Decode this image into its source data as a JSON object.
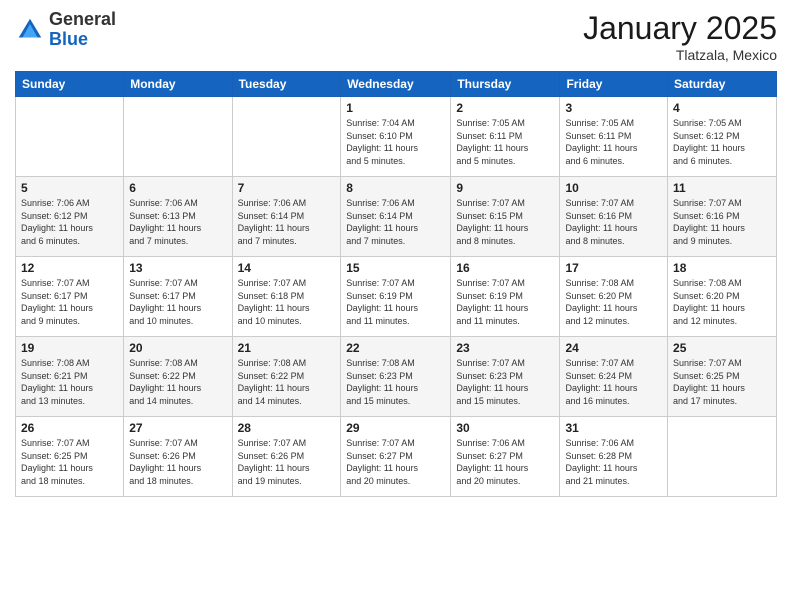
{
  "logo": {
    "general": "General",
    "blue": "Blue"
  },
  "header": {
    "month": "January 2025",
    "location": "Tlatzala, Mexico"
  },
  "weekdays": [
    "Sunday",
    "Monday",
    "Tuesday",
    "Wednesday",
    "Thursday",
    "Friday",
    "Saturday"
  ],
  "weeks": [
    [
      {
        "day": "",
        "info": ""
      },
      {
        "day": "",
        "info": ""
      },
      {
        "day": "",
        "info": ""
      },
      {
        "day": "1",
        "info": "Sunrise: 7:04 AM\nSunset: 6:10 PM\nDaylight: 11 hours\nand 5 minutes."
      },
      {
        "day": "2",
        "info": "Sunrise: 7:05 AM\nSunset: 6:11 PM\nDaylight: 11 hours\nand 5 minutes."
      },
      {
        "day": "3",
        "info": "Sunrise: 7:05 AM\nSunset: 6:11 PM\nDaylight: 11 hours\nand 6 minutes."
      },
      {
        "day": "4",
        "info": "Sunrise: 7:05 AM\nSunset: 6:12 PM\nDaylight: 11 hours\nand 6 minutes."
      }
    ],
    [
      {
        "day": "5",
        "info": "Sunrise: 7:06 AM\nSunset: 6:12 PM\nDaylight: 11 hours\nand 6 minutes."
      },
      {
        "day": "6",
        "info": "Sunrise: 7:06 AM\nSunset: 6:13 PM\nDaylight: 11 hours\nand 7 minutes."
      },
      {
        "day": "7",
        "info": "Sunrise: 7:06 AM\nSunset: 6:14 PM\nDaylight: 11 hours\nand 7 minutes."
      },
      {
        "day": "8",
        "info": "Sunrise: 7:06 AM\nSunset: 6:14 PM\nDaylight: 11 hours\nand 7 minutes."
      },
      {
        "day": "9",
        "info": "Sunrise: 7:07 AM\nSunset: 6:15 PM\nDaylight: 11 hours\nand 8 minutes."
      },
      {
        "day": "10",
        "info": "Sunrise: 7:07 AM\nSunset: 6:16 PM\nDaylight: 11 hours\nand 8 minutes."
      },
      {
        "day": "11",
        "info": "Sunrise: 7:07 AM\nSunset: 6:16 PM\nDaylight: 11 hours\nand 9 minutes."
      }
    ],
    [
      {
        "day": "12",
        "info": "Sunrise: 7:07 AM\nSunset: 6:17 PM\nDaylight: 11 hours\nand 9 minutes."
      },
      {
        "day": "13",
        "info": "Sunrise: 7:07 AM\nSunset: 6:17 PM\nDaylight: 11 hours\nand 10 minutes."
      },
      {
        "day": "14",
        "info": "Sunrise: 7:07 AM\nSunset: 6:18 PM\nDaylight: 11 hours\nand 10 minutes."
      },
      {
        "day": "15",
        "info": "Sunrise: 7:07 AM\nSunset: 6:19 PM\nDaylight: 11 hours\nand 11 minutes."
      },
      {
        "day": "16",
        "info": "Sunrise: 7:07 AM\nSunset: 6:19 PM\nDaylight: 11 hours\nand 11 minutes."
      },
      {
        "day": "17",
        "info": "Sunrise: 7:08 AM\nSunset: 6:20 PM\nDaylight: 11 hours\nand 12 minutes."
      },
      {
        "day": "18",
        "info": "Sunrise: 7:08 AM\nSunset: 6:20 PM\nDaylight: 11 hours\nand 12 minutes."
      }
    ],
    [
      {
        "day": "19",
        "info": "Sunrise: 7:08 AM\nSunset: 6:21 PM\nDaylight: 11 hours\nand 13 minutes."
      },
      {
        "day": "20",
        "info": "Sunrise: 7:08 AM\nSunset: 6:22 PM\nDaylight: 11 hours\nand 14 minutes."
      },
      {
        "day": "21",
        "info": "Sunrise: 7:08 AM\nSunset: 6:22 PM\nDaylight: 11 hours\nand 14 minutes."
      },
      {
        "day": "22",
        "info": "Sunrise: 7:08 AM\nSunset: 6:23 PM\nDaylight: 11 hours\nand 15 minutes."
      },
      {
        "day": "23",
        "info": "Sunrise: 7:07 AM\nSunset: 6:23 PM\nDaylight: 11 hours\nand 15 minutes."
      },
      {
        "day": "24",
        "info": "Sunrise: 7:07 AM\nSunset: 6:24 PM\nDaylight: 11 hours\nand 16 minutes."
      },
      {
        "day": "25",
        "info": "Sunrise: 7:07 AM\nSunset: 6:25 PM\nDaylight: 11 hours\nand 17 minutes."
      }
    ],
    [
      {
        "day": "26",
        "info": "Sunrise: 7:07 AM\nSunset: 6:25 PM\nDaylight: 11 hours\nand 18 minutes."
      },
      {
        "day": "27",
        "info": "Sunrise: 7:07 AM\nSunset: 6:26 PM\nDaylight: 11 hours\nand 18 minutes."
      },
      {
        "day": "28",
        "info": "Sunrise: 7:07 AM\nSunset: 6:26 PM\nDaylight: 11 hours\nand 19 minutes."
      },
      {
        "day": "29",
        "info": "Sunrise: 7:07 AM\nSunset: 6:27 PM\nDaylight: 11 hours\nand 20 minutes."
      },
      {
        "day": "30",
        "info": "Sunrise: 7:06 AM\nSunset: 6:27 PM\nDaylight: 11 hours\nand 20 minutes."
      },
      {
        "day": "31",
        "info": "Sunrise: 7:06 AM\nSunset: 6:28 PM\nDaylight: 11 hours\nand 21 minutes."
      },
      {
        "day": "",
        "info": ""
      }
    ]
  ]
}
